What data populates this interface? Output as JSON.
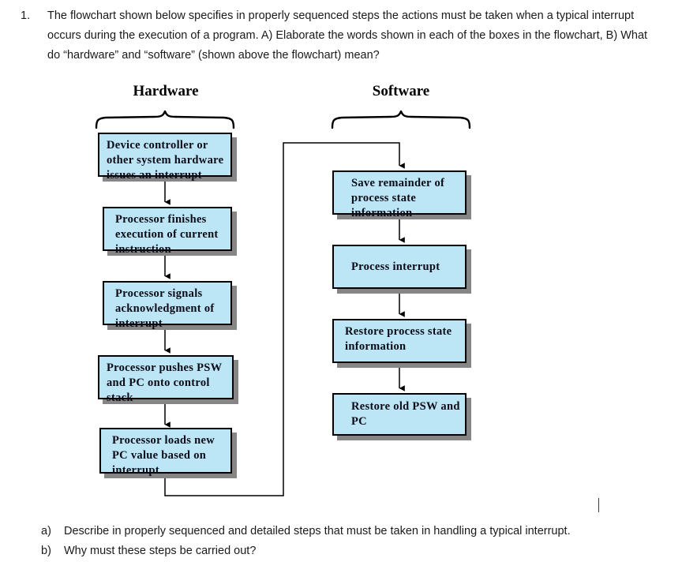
{
  "question": {
    "marker": "1.",
    "text": "The flowchart shown below specifies in properly sequenced steps the actions must be taken when a typical interrupt occurs during the execution of a program. A) Elaborate the words shown in each of the boxes in the flowchart, B) What do “hardware” and “software” (shown above the flowchart) mean?"
  },
  "flowchart": {
    "columns": [
      {
        "title": "Hardware"
      },
      {
        "title": "Software"
      }
    ],
    "hardware_steps": [
      {
        "text": "Device controller or other system hardware issues an interrupt"
      },
      {
        "text": "Processor finishes execution of current instruction"
      },
      {
        "text": "Processor signals acknowledgment of interrupt"
      },
      {
        "text": "Processor pushes PSW and PC onto control stack"
      },
      {
        "text": "Processor loads new PC value based on interrupt"
      }
    ],
    "software_steps": [
      {
        "text": "Save remainder of process state information"
      },
      {
        "text": "Process interrupt"
      },
      {
        "text": "Restore process state information"
      },
      {
        "text": "Restore old PSW and PC"
      }
    ],
    "colors": {
      "box_fill": "#bce5f5",
      "box_border": "#000000",
      "box_shadow": "#868686",
      "connector": "#000000"
    }
  },
  "subquestions": [
    {
      "marker": "a)",
      "text": "Describe in properly sequenced and detailed steps that must be taken in handling a typical interrupt."
    },
    {
      "marker": "b)",
      "text": "Why must these steps be carried out?"
    }
  ]
}
